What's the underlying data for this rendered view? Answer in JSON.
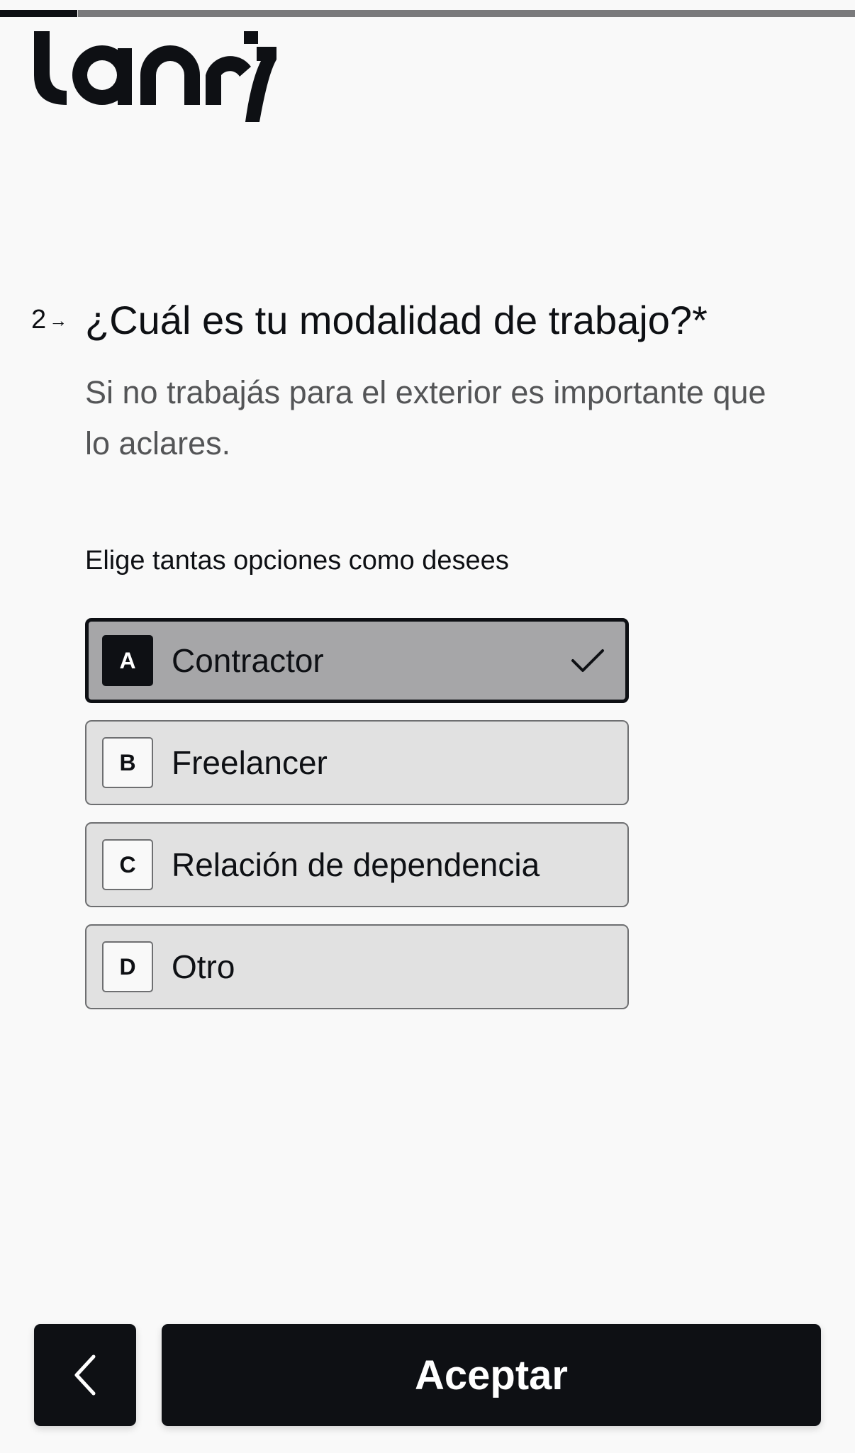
{
  "progress": {
    "value": 0.09
  },
  "brand": {
    "logo_text": "lannis"
  },
  "question": {
    "number": "2",
    "arrow_icon": "arrow-right-icon",
    "title": "¿Cuál es tu modalidad de trabajo?*",
    "description": "Si no trabajás para el exterior es importante que lo aclares.",
    "hint": "Elige tantas opciones como desees"
  },
  "choices": [
    {
      "key": "A",
      "label": "Contractor",
      "selected": true
    },
    {
      "key": "B",
      "label": "Freelancer",
      "selected": false
    },
    {
      "key": "C",
      "label": "Relación de dependencia",
      "selected": false
    },
    {
      "key": "D",
      "label": "Otro",
      "selected": false
    }
  ],
  "footer": {
    "back_icon": "chevron-left-icon",
    "accept_label": "Aceptar"
  },
  "colors": {
    "primary": "#0e1014",
    "background": "#f9f9f9",
    "choice_bg": "#e1e1e1",
    "choice_selected_bg": "#a6a6a8",
    "progress_track": "#7a7a7c",
    "muted_text": "#545557"
  }
}
